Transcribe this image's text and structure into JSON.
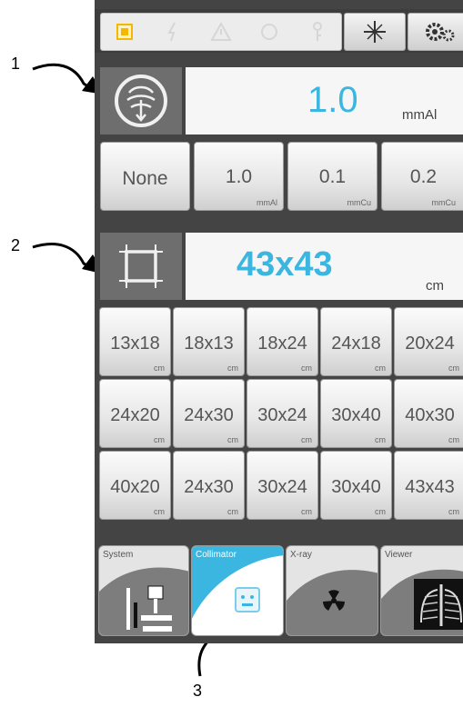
{
  "annotations": {
    "callout_1": "1",
    "callout_2": "2",
    "callout_3": "3"
  },
  "filter": {
    "value": "1.0",
    "unit": "mmAl",
    "options": [
      {
        "value": "None",
        "unit": ""
      },
      {
        "value": "1.0",
        "unit": "mmAl"
      },
      {
        "value": "0.1",
        "unit": "mmCu"
      },
      {
        "value": "0.2",
        "unit": "mmCu"
      }
    ]
  },
  "field_size": {
    "value": "43x43",
    "unit": "cm",
    "rows": [
      [
        {
          "value": "13x18",
          "unit": "cm"
        },
        {
          "value": "18x13",
          "unit": "cm"
        },
        {
          "value": "18x24",
          "unit": "cm"
        },
        {
          "value": "24x18",
          "unit": "cm"
        },
        {
          "value": "20x24",
          "unit": "cm"
        }
      ],
      [
        {
          "value": "24x20",
          "unit": "cm"
        },
        {
          "value": "24x30",
          "unit": "cm"
        },
        {
          "value": "30x24",
          "unit": "cm"
        },
        {
          "value": "30x40",
          "unit": "cm"
        },
        {
          "value": "40x30",
          "unit": "cm"
        }
      ],
      [
        {
          "value": "40x20",
          "unit": "cm"
        },
        {
          "value": "24x30",
          "unit": "cm"
        },
        {
          "value": "30x24",
          "unit": "cm"
        },
        {
          "value": "30x40",
          "unit": "cm"
        },
        {
          "value": "43x43",
          "unit": "cm"
        }
      ]
    ]
  },
  "tabs": [
    {
      "label": "System",
      "active": false,
      "icon": "system-stand-icon"
    },
    {
      "label": "Collimator",
      "active": true,
      "icon": "collimator-icon"
    },
    {
      "label": "X-ray",
      "active": false,
      "icon": "radiation-icon"
    },
    {
      "label": "Viewer",
      "active": false,
      "icon": "chest-xray-icon"
    }
  ],
  "colors": {
    "accent": "#3ab6e0",
    "panel": "#444444",
    "status_yellow": "#f5b800"
  },
  "status_icons": [
    "status-square-icon",
    "lightning-icon",
    "warning-icon",
    "circle-icon",
    "key-icon"
  ],
  "toolbar_icons": [
    "crosshair-icon",
    "settings-gears-icon"
  ]
}
